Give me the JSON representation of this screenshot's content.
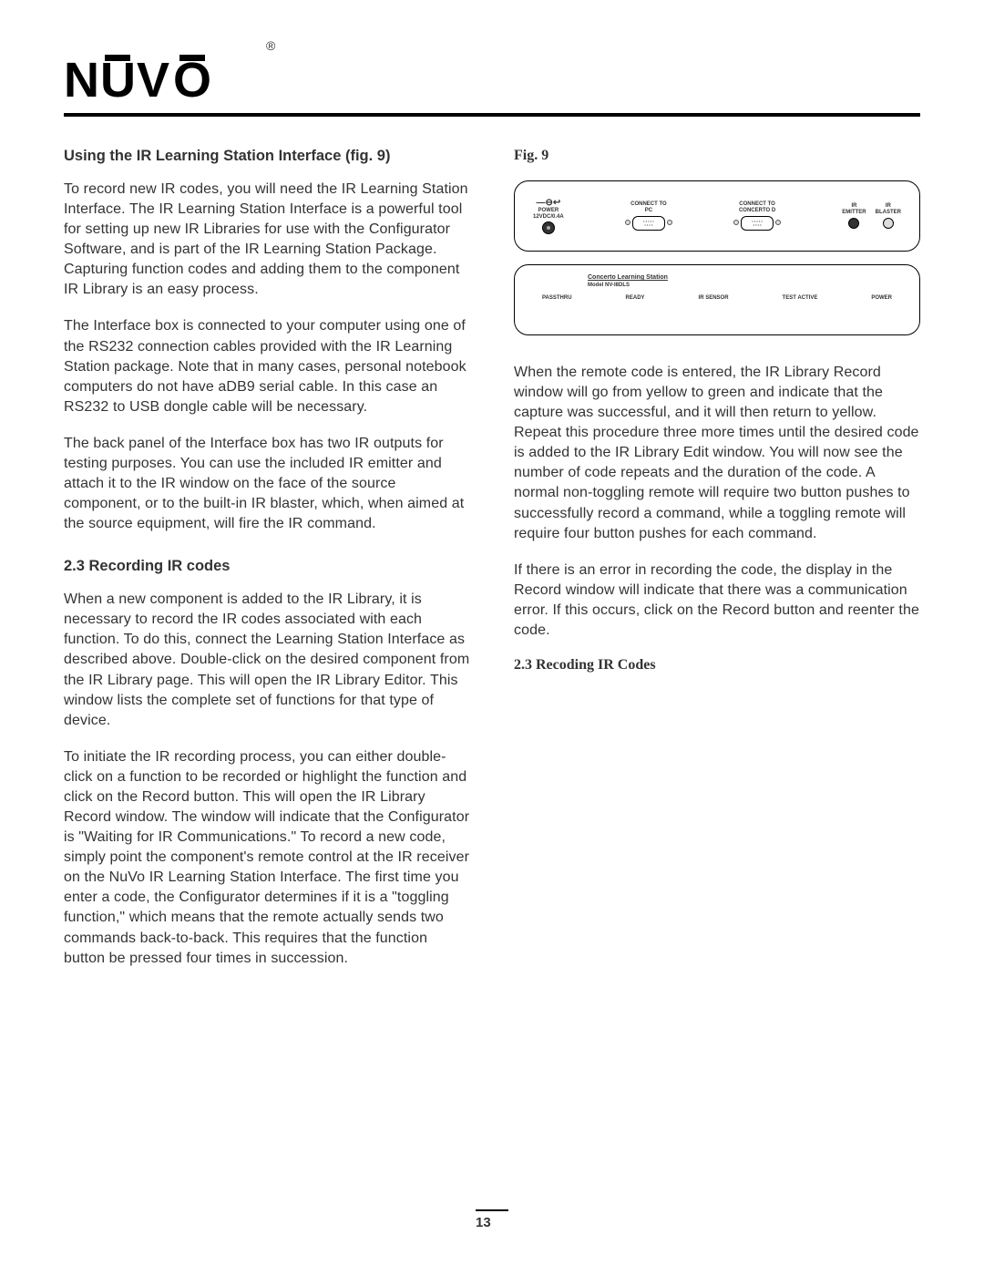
{
  "logo": {
    "text": "NUVO",
    "reg": "®"
  },
  "left": {
    "heading1": "Using the IR Learning Station Interface (fig. 9)",
    "p1": "To record new IR codes, you will need the IR Learning Station Interface. The IR Learning Station Interface is a powerful tool for setting up new IR Libraries for use with the Configurator Software, and is part of the IR Learning Station Package. Capturing function codes and adding them to the component IR Library is an easy process.",
    "p2": "The Interface box is connected to your computer using one of the RS232 connection cables provided with the IR Learning Station package. Note that in many cases, personal notebook computers do not have aDB9 serial cable. In this case an RS232 to USB dongle cable will be necessary.",
    "p3": "The back panel of the Interface box has two IR outputs for testing purposes. You can use the included IR emitter and attach it to the IR window on the face of the source component, or to the built-in IR blaster, which, when aimed at the source equipment, will fire the IR command.",
    "heading2": "2.3 Recording IR codes",
    "p4": "When a new component is added to the IR Library, it is necessary to record the IR codes associated with each function. To do this, connect the Learning Station Interface as described above. Double-click on the desired component from the IR Library page. This will open the IR Library Editor. This window lists the complete set of functions for that type of device.",
    "p5": "To initiate the IR recording process, you can either double-click on a function to be recorded or highlight the function and click on the Record button. This will open the IR Library Record window. The window will indicate that the Configurator is \"Waiting for IR Communications.\" To record a new code, simply point the component's remote control at the IR receiver on the NuVo IR Learning Station Interface. The first time you enter a code, the Configurator determines if it is a \"toggling function,\" which means that the remote actually sends two commands back-to-back. This requires that the function button be pressed four times in succession."
  },
  "right": {
    "figLabel": "Fig. 9",
    "diagram": {
      "back": {
        "power": "POWER\n12VDC/0.4A",
        "pc": "CONNECT TO\nPC",
        "concerto": "CONNECT TO\nCONCERTO D",
        "emitter": "IR\nEMITTER",
        "blaster": "IR\nBLASTER"
      },
      "front": {
        "title": "Concerto Learning Station",
        "model": "Model NV-I8DLS",
        "passthru": "PASSTHRU",
        "ready": "READY",
        "sensor": "IR SENSOR",
        "test": "TEST  ACTIVE",
        "power": "POWER"
      }
    },
    "p1": " When the remote code is entered, the IR Library Record window will go from yellow to green and indicate that the capture was successful, and it will then return to yellow. Repeat this procedure three more times until the desired code is added to the IR Library Edit window. You will now see the number of code repeats and the duration of the code. A normal non-toggling remote will require two button pushes to successfully record a command, while a toggling remote will require four button pushes for each command.",
    "p2": "If there is an error in recording the code, the display in the Record window will indicate that there was a communication error. If this occurs, click on the Record button and reenter the code.",
    "heading3": "2.3 Recoding IR Codes"
  },
  "pageNum": "13"
}
